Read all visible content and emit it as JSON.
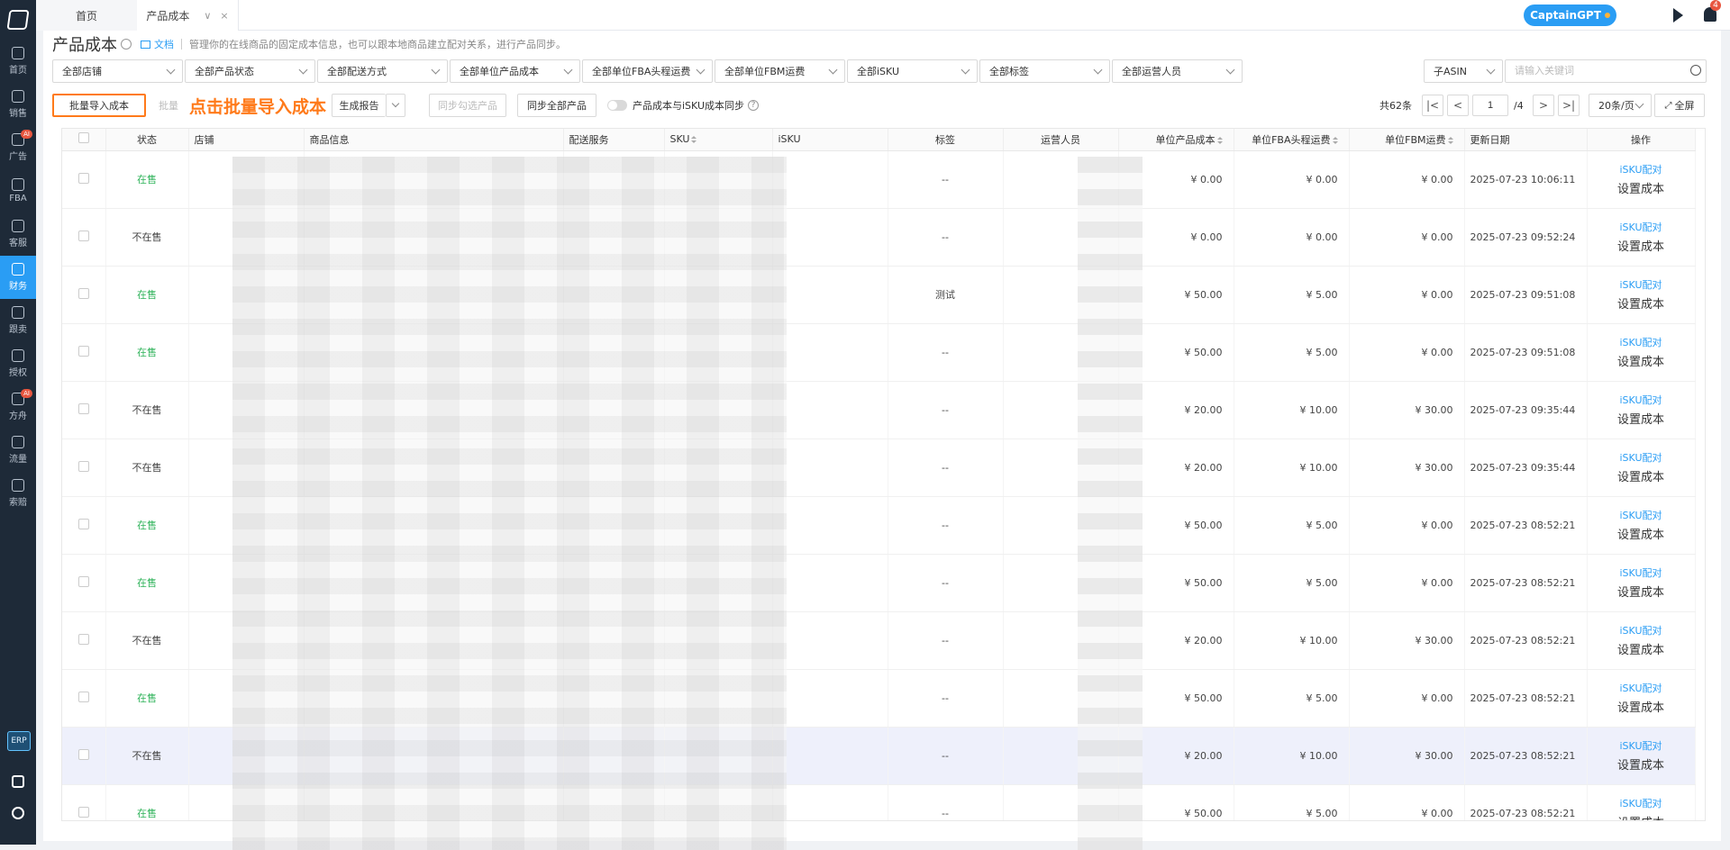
{
  "sidebar": {
    "items": [
      {
        "label": "首页",
        "active": false,
        "badge": ""
      },
      {
        "label": "销售",
        "active": false,
        "badge": ""
      },
      {
        "label": "广告",
        "active": false,
        "badge": "AI"
      },
      {
        "label": "FBA",
        "active": false,
        "badge": ""
      },
      {
        "label": "客服",
        "active": false,
        "badge": ""
      },
      {
        "label": "财务",
        "active": true,
        "badge": ""
      },
      {
        "label": "跟卖",
        "active": false,
        "badge": ""
      },
      {
        "label": "授权",
        "active": false,
        "badge": ""
      },
      {
        "label": "方舟",
        "active": false,
        "badge": "AI"
      },
      {
        "label": "流量",
        "active": false,
        "badge": ""
      },
      {
        "label": "索赔",
        "active": false,
        "badge": ""
      }
    ],
    "erp_label": "ERP"
  },
  "tabs": {
    "home": "首页",
    "active": "产品成本",
    "caret": "∨",
    "close": "×"
  },
  "header": {
    "gpt_label": "CaptainGPT",
    "notif_count": "4"
  },
  "page": {
    "title": "产品成本",
    "doc_label": "文档",
    "description": "管理你的在线商品的固定成本信息，也可以跟本地商品建立配对关系，进行产品同步。"
  },
  "filters": {
    "shop": "全部店铺",
    "status": "全部产品状态",
    "shipping": "全部配送方式",
    "unit_cost": "全部单位产品成本",
    "fba_freight": "全部单位FBA头程运费",
    "fbm_freight": "全部单位FBM运费",
    "isku": "全部iSKU",
    "tags": "全部标签",
    "operator": "全部运营人员",
    "search_type": "子ASIN",
    "search_placeholder": "请输入关键词"
  },
  "toolbar": {
    "batch_import": "批量导入成本",
    "batch_partial": "批量",
    "annotation": "点击批量导入成本",
    "report": "生成报告",
    "sync_selected": "同步勾选产品",
    "sync_all": "同步全部产品",
    "sync_toggle_label": "产品成本与iSKU成本同步",
    "help": "?"
  },
  "pagination": {
    "total": "共62条",
    "page": "1",
    "pages": "/4",
    "per_page": "20条/页",
    "fullscreen": "全屏",
    "first": "|<",
    "prev": "<",
    "next": ">",
    "last": ">|"
  },
  "table": {
    "columns": {
      "status": "状态",
      "shop": "店铺",
      "product": "商品信息",
      "shipping": "配送服务",
      "sku": "SKU",
      "isku": "iSKU",
      "tags": "标签",
      "operator": "运营人员",
      "unit_cost": "单位产品成本",
      "fba_freight": "单位FBA头程运费",
      "fbm_freight": "单位FBM运费",
      "updated": "更新日期",
      "actions": "操作"
    },
    "action_pair": "iSKU配对",
    "action_set": "设置成本",
    "rows": [
      {
        "status": "在售",
        "on": true,
        "tag": "--",
        "cost": "¥ 0.00",
        "fba": "¥ 0.00",
        "fbm": "¥ 0.00",
        "date": "2025-07-23 10:06:11"
      },
      {
        "status": "不在售",
        "on": false,
        "tag": "--",
        "cost": "¥ 0.00",
        "fba": "¥ 0.00",
        "fbm": "¥ 0.00",
        "date": "2025-07-23 09:52:24"
      },
      {
        "status": "在售",
        "on": true,
        "tag": "测试",
        "cost": "¥ 50.00",
        "fba": "¥ 5.00",
        "fbm": "¥ 0.00",
        "date": "2025-07-23 09:51:08"
      },
      {
        "status": "在售",
        "on": true,
        "tag": "--",
        "cost": "¥ 50.00",
        "fba": "¥ 5.00",
        "fbm": "¥ 0.00",
        "date": "2025-07-23 09:51:08"
      },
      {
        "status": "不在售",
        "on": false,
        "tag": "--",
        "cost": "¥ 20.00",
        "fba": "¥ 10.00",
        "fbm": "¥ 30.00",
        "date": "2025-07-23 09:35:44"
      },
      {
        "status": "不在售",
        "on": false,
        "tag": "--",
        "cost": "¥ 20.00",
        "fba": "¥ 10.00",
        "fbm": "¥ 30.00",
        "date": "2025-07-23 09:35:44"
      },
      {
        "status": "在售",
        "on": true,
        "tag": "--",
        "cost": "¥ 50.00",
        "fba": "¥ 5.00",
        "fbm": "¥ 0.00",
        "date": "2025-07-23 08:52:21"
      },
      {
        "status": "在售",
        "on": true,
        "tag": "--",
        "cost": "¥ 50.00",
        "fba": "¥ 5.00",
        "fbm": "¥ 0.00",
        "date": "2025-07-23 08:52:21"
      },
      {
        "status": "不在售",
        "on": false,
        "tag": "--",
        "cost": "¥ 20.00",
        "fba": "¥ 10.00",
        "fbm": "¥ 30.00",
        "date": "2025-07-23 08:52:21"
      },
      {
        "status": "在售",
        "on": true,
        "tag": "--",
        "cost": "¥ 50.00",
        "fba": "¥ 5.00",
        "fbm": "¥ 0.00",
        "date": "2025-07-23 08:52:21"
      },
      {
        "status": "不在售",
        "on": false,
        "tag": "--",
        "cost": "¥ 20.00",
        "fba": "¥ 10.00",
        "fbm": "¥ 30.00",
        "date": "2025-07-23 08:52:21"
      },
      {
        "status": "在售",
        "on": true,
        "tag": "--",
        "cost": "¥ 50.00",
        "fba": "¥ 5.00",
        "fbm": "¥ 0.00",
        "date": "2025-07-23 08:52:21"
      }
    ]
  },
  "colors": {
    "accent": "#2a9df4",
    "annotation": "#ff7a1a",
    "on_sale": "#2fb35a",
    "sidebar": "#1e2a38"
  }
}
